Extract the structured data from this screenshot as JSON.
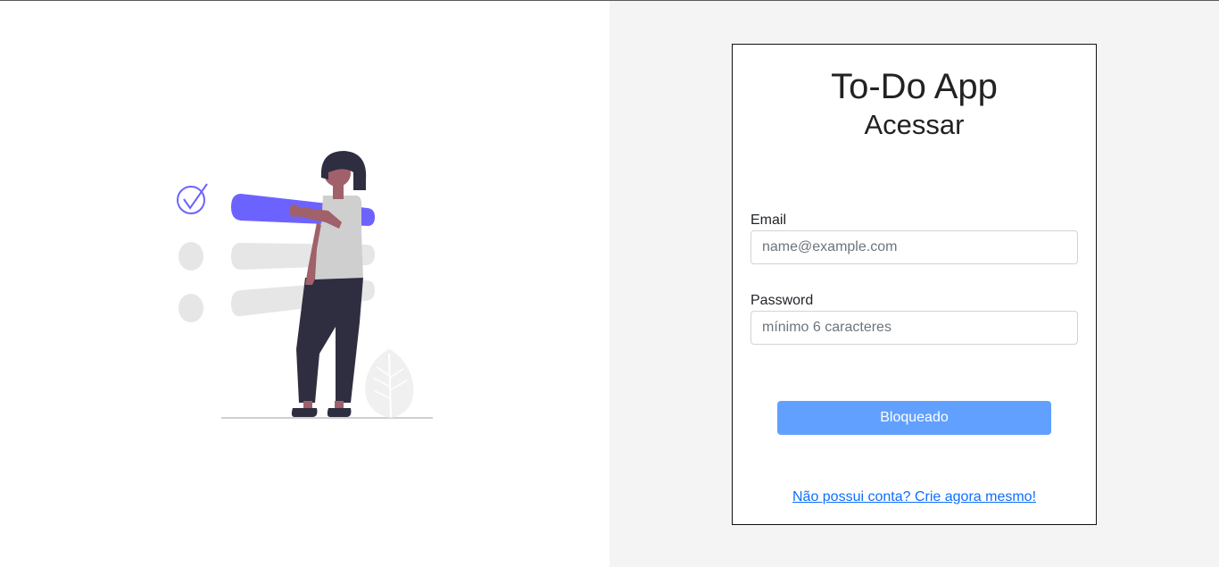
{
  "login": {
    "app_title": "To-Do App",
    "subtitle": "Acessar",
    "email_label": "Email",
    "email_placeholder": "name@example.com",
    "email_value": "",
    "password_label": "Password",
    "password_placeholder": "mínimo 6 caracteres",
    "password_value": "",
    "submit_label": "Bloqueado",
    "signup_link": "Não possui conta? Crie agora mesmo!"
  },
  "colors": {
    "accent": "#6c63ff",
    "button_disabled": "#62a0ff",
    "link": "#0d6efd",
    "right_panel_bg": "#f4f4f4"
  },
  "illustration": {
    "icon": "woman-todo-list-illustration",
    "checked_item_icon": "check-circle-icon"
  }
}
